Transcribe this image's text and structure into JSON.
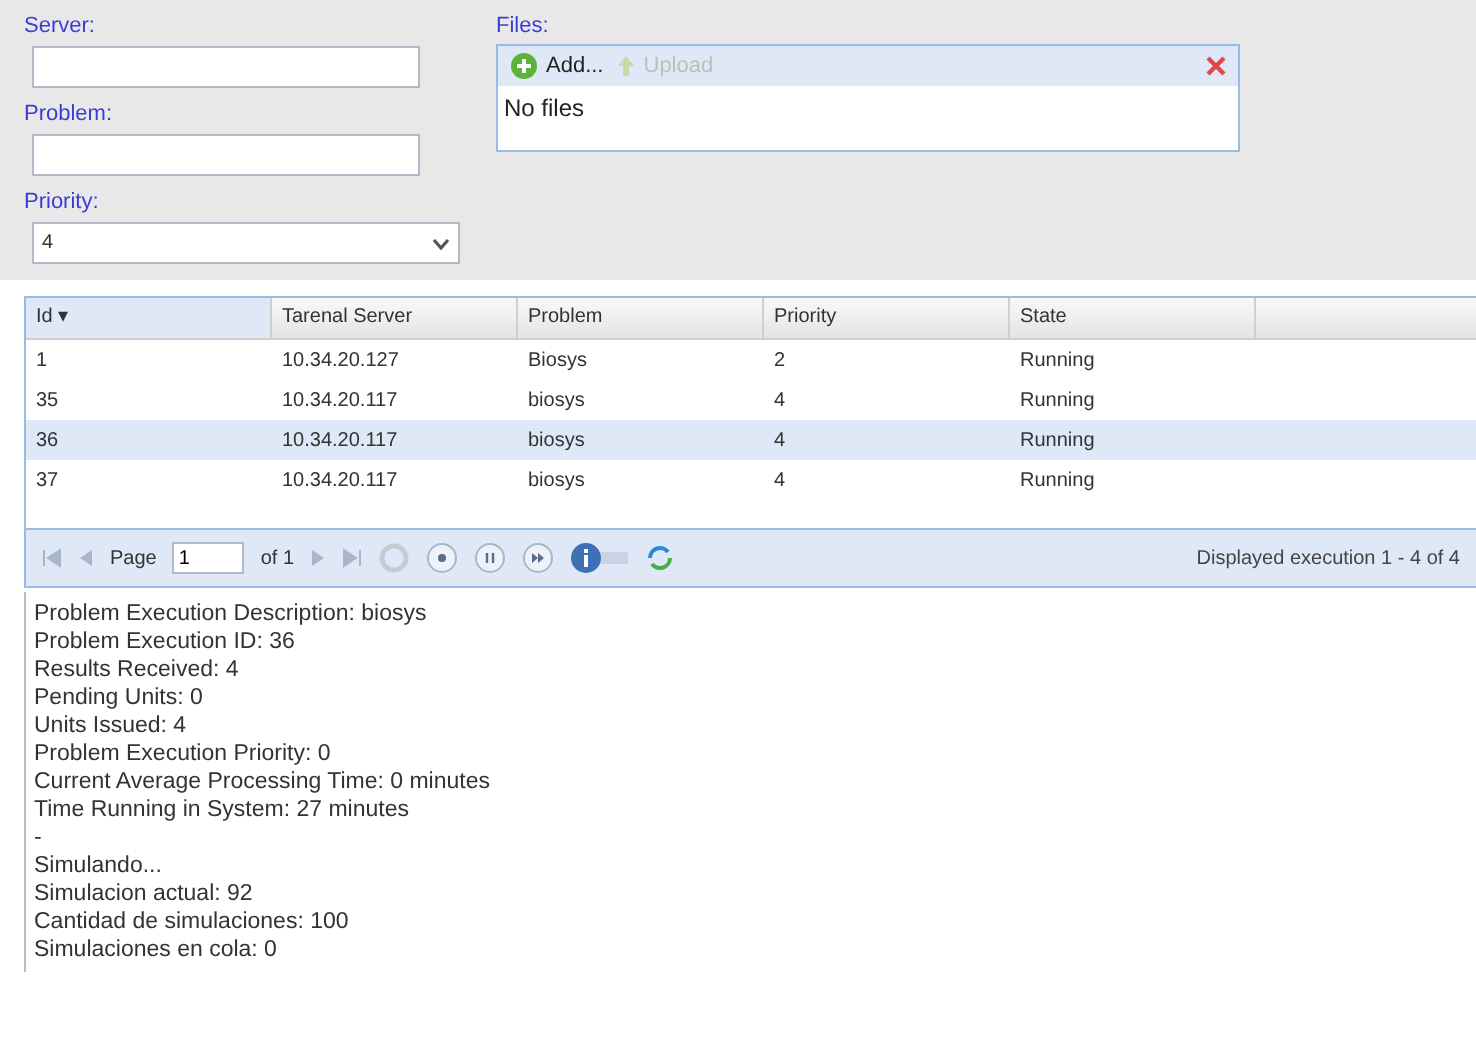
{
  "form": {
    "server": {
      "label": "Server:"
    },
    "problem": {
      "label": "Problem:"
    },
    "priority": {
      "label": "Priority:",
      "value": "4"
    }
  },
  "files": {
    "label": "Files:",
    "add": "Add...",
    "upload": {
      "label": "Upload",
      "disabled": true
    },
    "empty_text": "No files"
  },
  "table": {
    "columns": [
      "Id ▾",
      "Tarenal Server",
      "Problem",
      "Priority",
      "State"
    ],
    "rows": [
      {
        "cells": [
          "1",
          "10.34.20.127",
          "Biosys",
          "2",
          "Running"
        ],
        "selected": false
      },
      {
        "cells": [
          "35",
          "10.34.20.117",
          "biosys",
          "4",
          "Running"
        ],
        "selected": false
      },
      {
        "cells": [
          "36",
          "10.34.20.117",
          "biosys",
          "4",
          "Running"
        ],
        "selected": true
      },
      {
        "cells": [
          "37",
          "10.34.20.117",
          "biosys",
          "4",
          "Running"
        ],
        "selected": false
      }
    ]
  },
  "pager": {
    "page_label": "Page",
    "page": "1",
    "of": "of 1",
    "status": "Displayed execution 1 - 4 of 4"
  },
  "details": [
    "Problem Execution Description: biosys",
    "Problem Execution ID: 36",
    "Results Received: 4",
    "Pending Units: 0",
    "Units Issued: 4",
    "Problem Execution Priority: 0",
    "Current Average Processing Time: 0 minutes",
    "Time Running in System: 27 minutes",
    "-",
    "Simulando...",
    "Simulacion actual: 92",
    "Cantidad de simulaciones: 100",
    "Simulaciones en cola: 0"
  ]
}
